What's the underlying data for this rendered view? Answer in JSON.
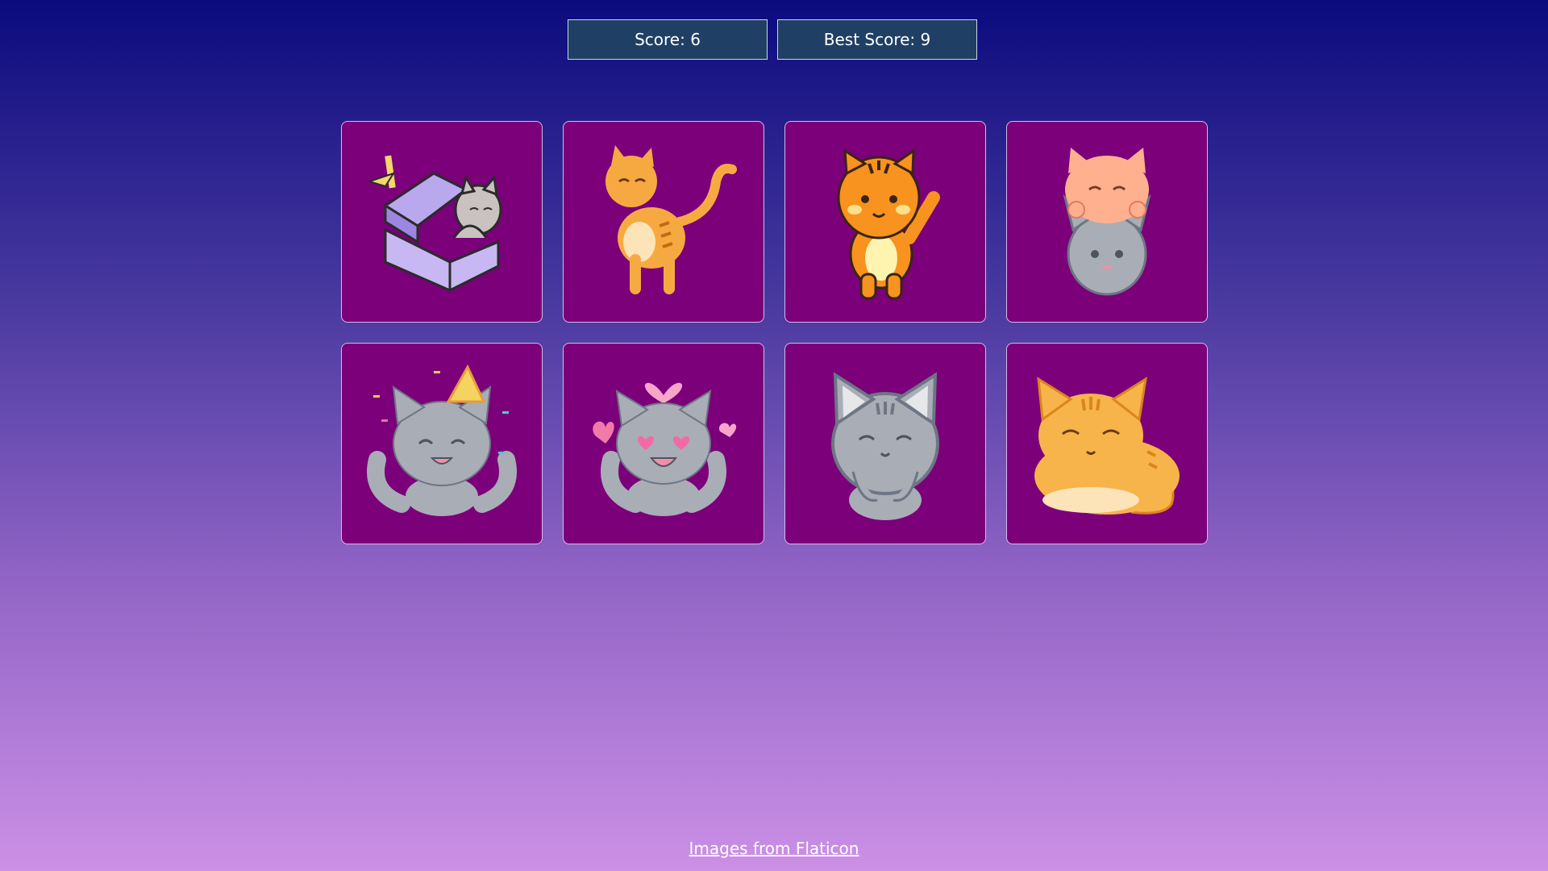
{
  "scoreboard": {
    "score_label": "Score: 6",
    "best_label": "Best Score: 9"
  },
  "cards": [
    {
      "icon": "cat-in-gift-box-icon"
    },
    {
      "icon": "orange-cat-walking-icon"
    },
    {
      "icon": "tiger-waving-icon"
    },
    {
      "icon": "two-cats-stacked-icon"
    },
    {
      "icon": "party-cat-icon"
    },
    {
      "icon": "love-cat-icon"
    },
    {
      "icon": "happy-gray-cat-icon"
    },
    {
      "icon": "sleeping-orange-cat-icon"
    }
  ],
  "colors": {
    "card_bg": "#7b007a",
    "score_bg": "#1f3f64",
    "gray_cat": "#a9adb6",
    "orange_cat": "#f7a941"
  },
  "footer": {
    "credit_link": "Images from Flaticon"
  }
}
